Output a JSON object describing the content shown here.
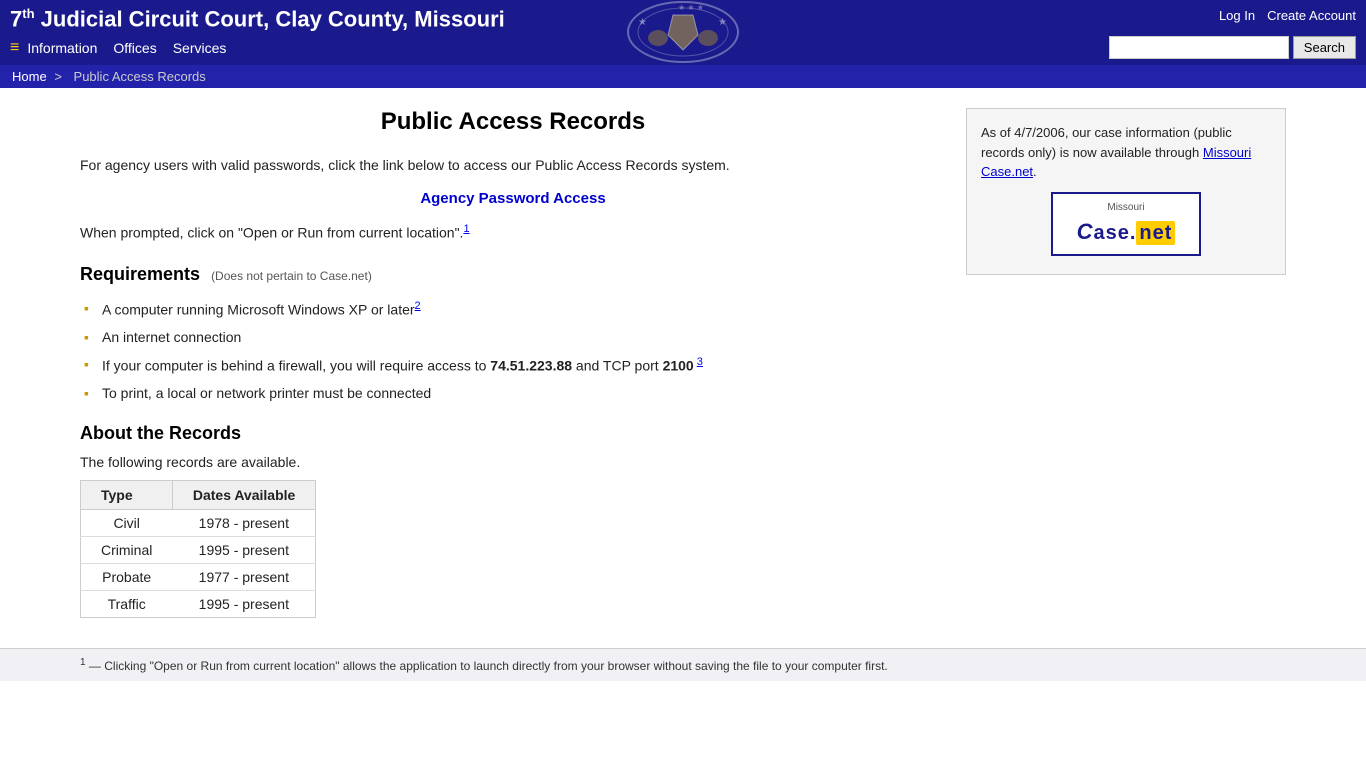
{
  "header": {
    "title_prefix": "7",
    "title_sup": "th",
    "title_suffix": " Judicial Circuit Court,  Clay County,  Missouri",
    "login_label": "Log In",
    "create_account_label": "Create Account",
    "search_button_label": "Search",
    "search_placeholder": "",
    "nav": {
      "menu_icon": "≡",
      "items": [
        "Information",
        "Offices",
        "Services"
      ]
    }
  },
  "breadcrumb": {
    "home_label": "Home",
    "separator": ">",
    "current": "Public Access Records"
  },
  "page": {
    "title": "Public Access Records",
    "intro": "For agency users with valid passwords, click the link below to access our Public Access Records system.",
    "agency_link_label": "Agency Password Access",
    "prompt_text": "When prompted, click on \"Open or Run from current location\".",
    "prompt_footnote": "1",
    "requirements_heading": "Requirements",
    "requirements_subtitle": "(Does not pertain to Case.net)",
    "requirements": [
      {
        "text": "A computer running Microsoft Windows XP or later",
        "footnote": "2"
      },
      {
        "text": "An internet connection",
        "footnote": ""
      },
      {
        "text_before": "If your computer is behind a firewall, you will require access to ",
        "bold": "74.51.223.88",
        "text_mid": " and TCP port ",
        "bold2": "2100",
        "footnote": "3"
      },
      {
        "text": "To print, a local or network printer must be connected",
        "footnote": ""
      }
    ],
    "about_heading": "About the Records",
    "about_text": "The following records are available.",
    "table": {
      "col1_header": "Type",
      "col2_header": "Dates Available",
      "rows": [
        {
          "type": "Civil",
          "dates": "1978 - present"
        },
        {
          "type": "Criminal",
          "dates": "1995 - present"
        },
        {
          "type": "Probate",
          "dates": "1977 - present"
        },
        {
          "type": "Traffic",
          "dates": "1995 - present"
        }
      ]
    }
  },
  "sidebar": {
    "notice_text": "As of 4/7/2006, our case information (public records only) is now available through",
    "casenet_link_label": "Missouri Case.net",
    "casenet_link_suffix": ".",
    "logo_c": "C",
    "logo_missouri": "Missouri",
    "logo_case": "Case.",
    "logo_net": "net"
  },
  "footnotes": {
    "note1_prefix": "1",
    "note1_text": " — Clicking \"Open or Run from current location\" allows the application to launch directly from your browser without saving the file to your computer first."
  }
}
